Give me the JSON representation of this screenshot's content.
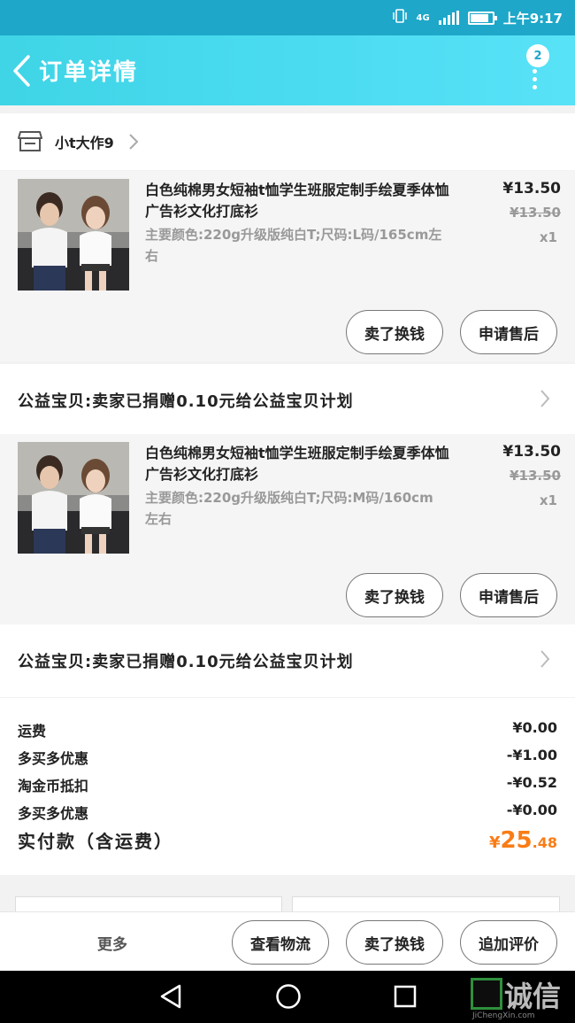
{
  "status_bar": {
    "network": "4G",
    "time": "上午9:17"
  },
  "nav": {
    "title": "订单详情",
    "badge": "2"
  },
  "shop": {
    "name": "小t大作9"
  },
  "items": [
    {
      "title": "白色纯棉男女短袖t恤学生班服定制手绘夏季体恤广告衫文化打底衫",
      "spec": "主要颜色:220g升级版纯白T;尺码:L码/165cm左右",
      "price": "¥13.50",
      "original_price": "¥13.50",
      "qty": "x1",
      "btn_exchange": "卖了换钱",
      "btn_aftersale": "申请售后"
    },
    {
      "title": "白色纯棉男女短袖t恤学生班服定制手绘夏季体恤广告衫文化打底衫",
      "spec": "主要颜色:220g升级版纯白T;尺码:M码/160cm左右",
      "price": "¥13.50",
      "original_price": "¥13.50",
      "qty": "x1",
      "btn_exchange": "卖了换钱",
      "btn_aftersale": "申请售后"
    }
  ],
  "charity": {
    "text": "公益宝贝:卖家已捐赠0.10元给公益宝贝计划"
  },
  "summary": {
    "rows": [
      {
        "label": "运费",
        "value": "¥0.00"
      },
      {
        "label": "多买多优惠",
        "value": "-¥1.00"
      },
      {
        "label": "淘金币抵扣",
        "value": "-¥0.52"
      },
      {
        "label": "多买多优惠",
        "value": "-¥0.00"
      }
    ],
    "total_label": "实付款（含运费）",
    "total_currency": "¥",
    "total_int": "25",
    "total_dec": ".48"
  },
  "bottom": {
    "more": "更多",
    "logistics": "查看物流",
    "exchange": "卖了换钱",
    "review": "追加评价"
  },
  "watermark": {
    "brand": "诚信",
    "site": "JiChengXin.com"
  },
  "colors": {
    "nav": "#46d8ef",
    "total": "#f97c16"
  }
}
